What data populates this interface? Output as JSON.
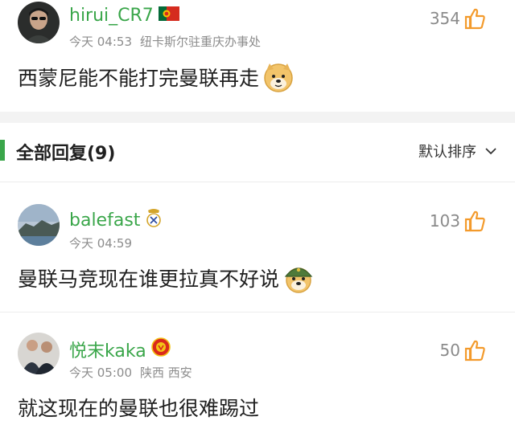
{
  "top_post": {
    "username": "hirui_CR7",
    "flag_icon": "portugal-flag-icon",
    "time": "今天 04:53",
    "location": "纽卡斯尔驻重庆办事处",
    "likes": "354",
    "content": "西蒙尼能不能打完曼联再走"
  },
  "replies_header": {
    "title": "全部回复(9)",
    "sort_label": "默认排序"
  },
  "replies": [
    {
      "username": "balefast",
      "badge": "real-madrid-badge-icon",
      "time": "今天 04:59",
      "location": "",
      "likes": "103",
      "content": "曼联马竞现在谁更拉真不好说"
    },
    {
      "username": "悦末kaka",
      "badge": "man-utd-badge-icon",
      "time": "今天 05:00",
      "location": "陕西 西安",
      "likes": "50",
      "content": "就这现在的曼联也很难踢过"
    }
  ],
  "colors": {
    "accent_green": "#3aa64a",
    "like_orange": "#f39a2b",
    "meta_gray": "#8c8c8c"
  }
}
